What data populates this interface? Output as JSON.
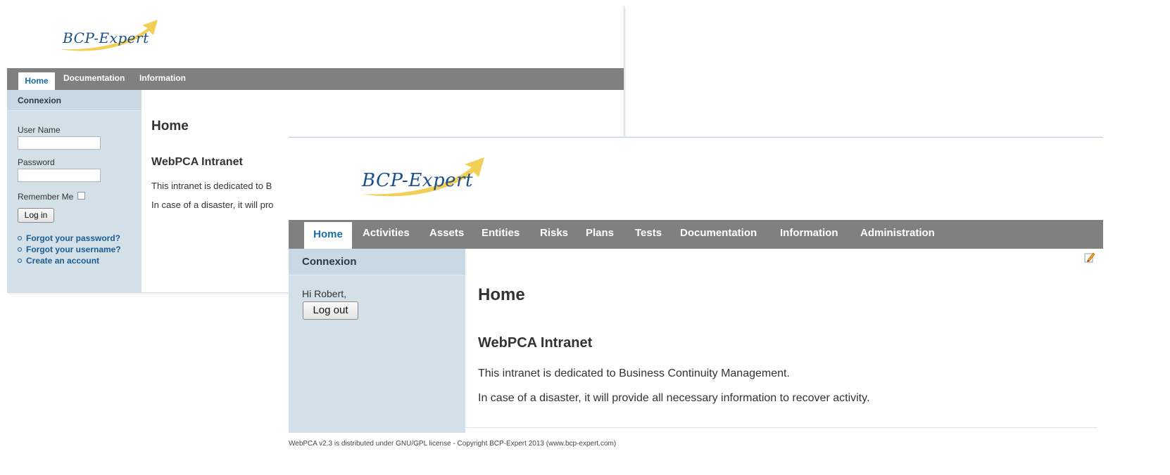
{
  "login_page": {
    "logo_text": "BCP-Expert",
    "nav": [
      "Home",
      "Documentation",
      "Information"
    ],
    "sidebar": {
      "heading": "Connexion",
      "username_label": "User Name",
      "password_label": "Password",
      "remember_label": "Remember Me",
      "login_button": "Log in",
      "links": [
        "Forgot your password?",
        "Forgot your username?",
        "Create an account"
      ]
    },
    "main": {
      "title": "Home",
      "subtitle": "WebPCA Intranet",
      "line1": "This intranet is dedicated to B",
      "line2": "In case of a disaster, it will pro"
    }
  },
  "user_page": {
    "logo_text": "BCP-Expert",
    "nav": [
      "Home",
      "Activities",
      "Assets",
      "Entities",
      "Risks",
      "Plans",
      "Tests",
      "Documentation",
      "Information",
      "Administration"
    ],
    "sidebar": {
      "heading": "Connexion",
      "greeting": "Hi Robert,",
      "logout_button": "Log out"
    },
    "main": {
      "title": "Home",
      "subtitle": "WebPCA Intranet",
      "line1": "This intranet is dedicated to Business Continuity Management.",
      "line2": "In case of a disaster, it will provide all necessary information to recover activity."
    },
    "footer": "WebPCA v2.3 is distributed under GNU/GPL license - Copyright BCP-Expert 2013 (www.bcp-expert.com)"
  },
  "colors": {
    "nav_bg": "#808080",
    "sidebar_bg": "#d3e0e8",
    "link": "#1a5d96",
    "active_tab_text": "#1a6ea8",
    "logo_swoosh": "#f2cf56"
  }
}
